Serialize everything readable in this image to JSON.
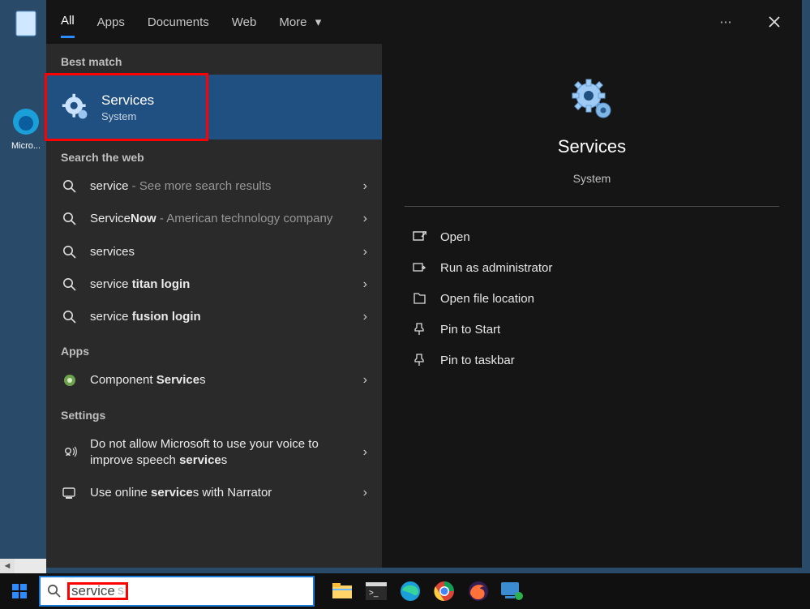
{
  "desktop": {
    "icon_label": "Micro..."
  },
  "tabs": {
    "items": [
      "All",
      "Apps",
      "Documents",
      "Web",
      "More"
    ],
    "active_index": 0
  },
  "left": {
    "best_match_label": "Best match",
    "best_match": {
      "title": "Services",
      "subtitle": "System"
    },
    "web_label": "Search the web",
    "web_results": [
      {
        "prefix": "service",
        "suffix": " - See more search results"
      },
      {
        "prefix": "Service",
        "bold": "Now",
        "suffix": " - American technology company"
      },
      {
        "prefix": "services",
        "suffix": ""
      },
      {
        "prefix": "service ",
        "bold": "titan login",
        "suffix": ""
      },
      {
        "prefix": "service ",
        "bold": "fusion login",
        "suffix": ""
      }
    ],
    "apps_label": "Apps",
    "apps": [
      {
        "pre": "Component ",
        "bold": "Service",
        "post": "s"
      }
    ],
    "settings_label": "Settings",
    "settings": [
      {
        "pre": "Do not allow Microsoft to use your voice to improve speech ",
        "bold": "service",
        "post": "s"
      },
      {
        "pre": "Use online ",
        "bold": "service",
        "post": "s with Narrator"
      }
    ]
  },
  "right": {
    "title": "Services",
    "subtitle": "System",
    "actions": [
      "Open",
      "Run as administrator",
      "Open file location",
      "Pin to Start",
      "Pin to taskbar"
    ]
  },
  "taskbar": {
    "search_value": "service",
    "search_trailing": "s"
  }
}
